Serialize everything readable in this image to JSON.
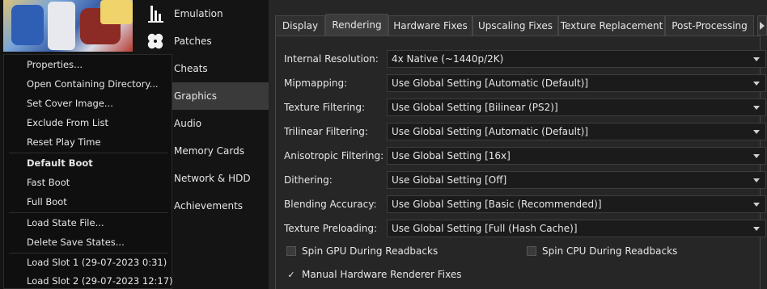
{
  "context_menu": {
    "items": [
      {
        "label": "Properties...",
        "bold": false
      },
      {
        "label": "Open Containing Directory...",
        "bold": false
      },
      {
        "label": "Set Cover Image...",
        "bold": false
      },
      {
        "label": "Exclude From List",
        "bold": false
      },
      {
        "label": "Reset Play Time",
        "bold": false
      },
      {
        "label": "Default Boot",
        "bold": true
      },
      {
        "label": "Fast Boot",
        "bold": false
      },
      {
        "label": "Full Boot",
        "bold": false
      },
      {
        "label": "Load State File...",
        "bold": false
      },
      {
        "label": "Delete Save States...",
        "bold": false
      },
      {
        "label": "Load Slot 1 (29-07-2023 0:31)",
        "bold": false
      },
      {
        "label": "Load Slot 2 (29-07-2023 12:17)",
        "bold": false
      }
    ]
  },
  "settings_nav": {
    "items": [
      {
        "label": "Emulation",
        "icon": "emulation-icon"
      },
      {
        "label": "Patches",
        "icon": "bandage-icon"
      },
      {
        "label": "Cheats",
        "icon": "cheats-icon"
      },
      {
        "label": "Graphics",
        "icon": "graphics-icon",
        "active": true
      },
      {
        "label": "Audio",
        "icon": "audio-icon"
      },
      {
        "label": "Memory Cards",
        "icon": "memory-card-icon"
      },
      {
        "label": "Network & HDD",
        "icon": "network-icon"
      },
      {
        "label": "Achievements",
        "icon": "trophy-icon"
      }
    ]
  },
  "tabs": {
    "items": [
      "Display",
      "Rendering",
      "Hardware Fixes",
      "Upscaling Fixes",
      "Texture Replacement",
      "Post-Processing"
    ],
    "active": "Rendering"
  },
  "rendering": {
    "settings": [
      {
        "label": "Internal Resolution:",
        "value": "4x Native (~1440p/2K)"
      },
      {
        "label": "Mipmapping:",
        "value": "Use Global Setting [Automatic (Default)]"
      },
      {
        "label": "Texture Filtering:",
        "value": "Use Global Setting [Bilinear (PS2)]"
      },
      {
        "label": "Trilinear Filtering:",
        "value": "Use Global Setting [Automatic (Default)]"
      },
      {
        "label": "Anisotropic Filtering:",
        "value": "Use Global Setting [16x]"
      },
      {
        "label": "Dithering:",
        "value": "Use Global Setting [Off]"
      },
      {
        "label": "Blending Accuracy:",
        "value": "Use Global Setting [Basic (Recommended)]"
      },
      {
        "label": "Texture Preloading:",
        "value": "Use Global Setting [Full (Hash Cache)]"
      }
    ],
    "checkboxes": [
      {
        "label": "Spin GPU During Readbacks",
        "checked": false
      },
      {
        "label": "Spin CPU During Readbacks",
        "checked": false
      },
      {
        "label": "Manual Hardware Renderer Fixes",
        "checked": true
      }
    ]
  },
  "colors": {
    "background": "#1e1e1e",
    "nav_active": "#3a3a3a",
    "panel": "#262626"
  }
}
